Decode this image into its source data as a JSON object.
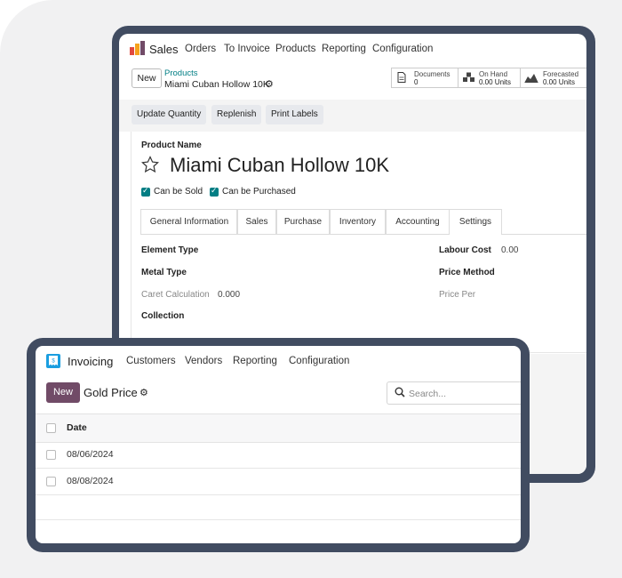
{
  "sales_window": {
    "app_name": "Sales",
    "menu": [
      "Orders",
      "To Invoice",
      "Products",
      "Reporting",
      "Configuration"
    ],
    "new_button": "New",
    "breadcrumb_parent": "Products",
    "breadcrumb_current": "Miami Cuban Hollow 10K",
    "smart_buttons": [
      {
        "label": "Documents",
        "value": "0",
        "icon": "document-icon"
      },
      {
        "label": "On Hand",
        "value": "0.00 Units",
        "icon": "cubes-icon"
      },
      {
        "label": "Forecasted",
        "value": "0.00 Units",
        "icon": "area-chart-icon"
      }
    ],
    "action_buttons": [
      "Update Quantity",
      "Replenish",
      "Print Labels"
    ],
    "product_name_label": "Product Name",
    "product_name": "Miami Cuban Hollow 10K",
    "checkboxes": [
      {
        "label": "Can be Sold",
        "checked": true
      },
      {
        "label": "Can be Purchased",
        "checked": true
      }
    ],
    "tabs": [
      "General Information",
      "Sales",
      "Purchase",
      "Inventory",
      "Accounting",
      "Settings"
    ],
    "active_tab": "Settings",
    "fields_left": {
      "element_type": "Element Type",
      "metal_type": "Metal Type",
      "caret_calculation_label": "Caret Calculation",
      "caret_calculation_value": "0.000",
      "collection": "Collection"
    },
    "fields_right": {
      "labour_cost_label": "Labour Cost",
      "labour_cost_value": "0.00",
      "price_method": "Price Method",
      "price_per": "Price Per"
    }
  },
  "invoicing_window": {
    "app_name": "Invoicing",
    "menu": [
      "Customers",
      "Vendors",
      "Reporting",
      "Configuration"
    ],
    "new_button": "New",
    "title": "Gold Price",
    "search_placeholder": "Search...",
    "column_header": "Date",
    "rows": [
      "08/06/2024",
      "08/08/2024"
    ]
  },
  "colors": {
    "brand_purple": "#714b67",
    "accent_teal": "#017e84",
    "frame": "#414c61"
  }
}
